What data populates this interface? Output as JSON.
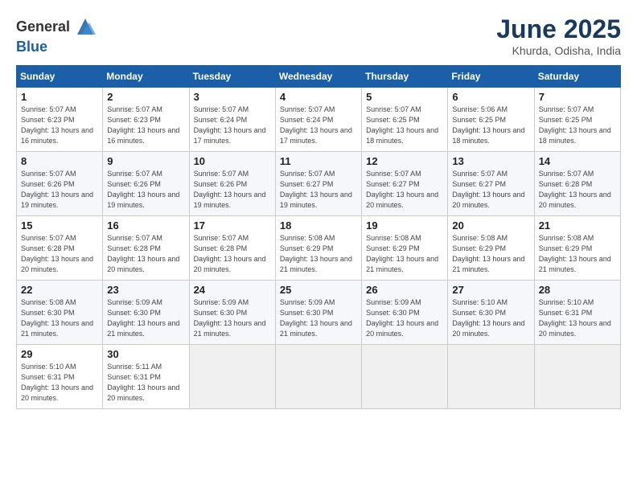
{
  "header": {
    "logo_general": "General",
    "logo_blue": "Blue",
    "month_title": "June 2025",
    "location": "Khurda, Odisha, India"
  },
  "weekdays": [
    "Sunday",
    "Monday",
    "Tuesday",
    "Wednesday",
    "Thursday",
    "Friday",
    "Saturday"
  ],
  "weeks": [
    [
      {
        "day": "1",
        "sunrise": "5:07 AM",
        "sunset": "6:23 PM",
        "daylight": "13 hours and 16 minutes."
      },
      {
        "day": "2",
        "sunrise": "5:07 AM",
        "sunset": "6:23 PM",
        "daylight": "13 hours and 16 minutes."
      },
      {
        "day": "3",
        "sunrise": "5:07 AM",
        "sunset": "6:24 PM",
        "daylight": "13 hours and 17 minutes."
      },
      {
        "day": "4",
        "sunrise": "5:07 AM",
        "sunset": "6:24 PM",
        "daylight": "13 hours and 17 minutes."
      },
      {
        "day": "5",
        "sunrise": "5:07 AM",
        "sunset": "6:25 PM",
        "daylight": "13 hours and 18 minutes."
      },
      {
        "day": "6",
        "sunrise": "5:06 AM",
        "sunset": "6:25 PM",
        "daylight": "13 hours and 18 minutes."
      },
      {
        "day": "7",
        "sunrise": "5:07 AM",
        "sunset": "6:25 PM",
        "daylight": "13 hours and 18 minutes."
      }
    ],
    [
      {
        "day": "8",
        "sunrise": "5:07 AM",
        "sunset": "6:26 PM",
        "daylight": "13 hours and 19 minutes."
      },
      {
        "day": "9",
        "sunrise": "5:07 AM",
        "sunset": "6:26 PM",
        "daylight": "13 hours and 19 minutes."
      },
      {
        "day": "10",
        "sunrise": "5:07 AM",
        "sunset": "6:26 PM",
        "daylight": "13 hours and 19 minutes."
      },
      {
        "day": "11",
        "sunrise": "5:07 AM",
        "sunset": "6:27 PM",
        "daylight": "13 hours and 19 minutes."
      },
      {
        "day": "12",
        "sunrise": "5:07 AM",
        "sunset": "6:27 PM",
        "daylight": "13 hours and 20 minutes."
      },
      {
        "day": "13",
        "sunrise": "5:07 AM",
        "sunset": "6:27 PM",
        "daylight": "13 hours and 20 minutes."
      },
      {
        "day": "14",
        "sunrise": "5:07 AM",
        "sunset": "6:28 PM",
        "daylight": "13 hours and 20 minutes."
      }
    ],
    [
      {
        "day": "15",
        "sunrise": "5:07 AM",
        "sunset": "6:28 PM",
        "daylight": "13 hours and 20 minutes."
      },
      {
        "day": "16",
        "sunrise": "5:07 AM",
        "sunset": "6:28 PM",
        "daylight": "13 hours and 20 minutes."
      },
      {
        "day": "17",
        "sunrise": "5:07 AM",
        "sunset": "6:28 PM",
        "daylight": "13 hours and 20 minutes."
      },
      {
        "day": "18",
        "sunrise": "5:08 AM",
        "sunset": "6:29 PM",
        "daylight": "13 hours and 21 minutes."
      },
      {
        "day": "19",
        "sunrise": "5:08 AM",
        "sunset": "6:29 PM",
        "daylight": "13 hours and 21 minutes."
      },
      {
        "day": "20",
        "sunrise": "5:08 AM",
        "sunset": "6:29 PM",
        "daylight": "13 hours and 21 minutes."
      },
      {
        "day": "21",
        "sunrise": "5:08 AM",
        "sunset": "6:29 PM",
        "daylight": "13 hours and 21 minutes."
      }
    ],
    [
      {
        "day": "22",
        "sunrise": "5:08 AM",
        "sunset": "6:30 PM",
        "daylight": "13 hours and 21 minutes."
      },
      {
        "day": "23",
        "sunrise": "5:09 AM",
        "sunset": "6:30 PM",
        "daylight": "13 hours and 21 minutes."
      },
      {
        "day": "24",
        "sunrise": "5:09 AM",
        "sunset": "6:30 PM",
        "daylight": "13 hours and 21 minutes."
      },
      {
        "day": "25",
        "sunrise": "5:09 AM",
        "sunset": "6:30 PM",
        "daylight": "13 hours and 21 minutes."
      },
      {
        "day": "26",
        "sunrise": "5:09 AM",
        "sunset": "6:30 PM",
        "daylight": "13 hours and 20 minutes."
      },
      {
        "day": "27",
        "sunrise": "5:10 AM",
        "sunset": "6:30 PM",
        "daylight": "13 hours and 20 minutes."
      },
      {
        "day": "28",
        "sunrise": "5:10 AM",
        "sunset": "6:31 PM",
        "daylight": "13 hours and 20 minutes."
      }
    ],
    [
      {
        "day": "29",
        "sunrise": "5:10 AM",
        "sunset": "6:31 PM",
        "daylight": "13 hours and 20 minutes."
      },
      {
        "day": "30",
        "sunrise": "5:11 AM",
        "sunset": "6:31 PM",
        "daylight": "13 hours and 20 minutes."
      },
      null,
      null,
      null,
      null,
      null
    ]
  ]
}
